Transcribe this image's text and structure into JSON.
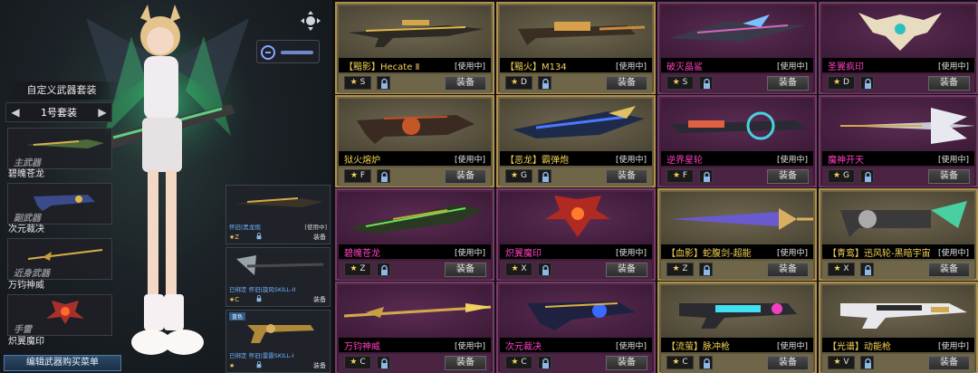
{
  "left_panel": {
    "loadout_title": "自定义武器套装",
    "set_name": "1号套装",
    "prev_arrow": "◀",
    "next_arrow": "▶",
    "slots": [
      {
        "type": "主武器",
        "name": "碧魄苍龙"
      },
      {
        "type": "副武器",
        "name": "次元裁决"
      },
      {
        "type": "近身武器",
        "name": "万钧神威"
      },
      {
        "type": "手雷",
        "name": "炽翼魔印"
      }
    ],
    "edit_button": "编辑武器购买菜单"
  },
  "mid_list": [
    {
      "badge": "",
      "name": "怀旧|黑龙炮",
      "status": "[使用中]",
      "key": "★Z",
      "equip": "装备"
    },
    {
      "badge": "",
      "name": "已绑定 怀旧|旋风SKILL-II",
      "status": "",
      "key": "★C",
      "equip": "装备"
    },
    {
      "badge": "蓝色",
      "name": "已绑定 怀旧|雷霆SKILL-I",
      "status": "",
      "key": "★",
      "equip": "装备"
    }
  ],
  "weapons": [
    {
      "name": "【黯影】Hecate Ⅱ",
      "status": "[使用中]",
      "key": "S",
      "equip": "装备",
      "style": "gold",
      "icon": "sniper-rifle-icon"
    },
    {
      "name": "【黯火】M134",
      "status": "[使用中]",
      "key": "D",
      "equip": "装备",
      "style": "gold",
      "icon": "minigun-icon"
    },
    {
      "name": "破灭晶鲨",
      "status": "[使用中]",
      "key": "S",
      "equip": "装备",
      "style": "purple",
      "icon": "shark-blade-icon"
    },
    {
      "name": "圣翼疯印",
      "status": "[使用中]",
      "key": "D",
      "equip": "装备",
      "style": "purple",
      "icon": "winged-emblem-icon"
    },
    {
      "name": "狱火熔炉",
      "status": "[使用中]",
      "key": "F",
      "equip": "装备",
      "style": "gold",
      "icon": "furnace-gun-icon"
    },
    {
      "name": "【恶龙】霸弹炮",
      "status": "[使用中]",
      "key": "G",
      "equip": "装备",
      "style": "gold",
      "icon": "dragon-cannon-icon"
    },
    {
      "name": "逆界星轮",
      "status": "[使用中]",
      "key": "F",
      "equip": "装备",
      "style": "purple",
      "icon": "star-wheel-icon"
    },
    {
      "name": "魔神开天",
      "status": "[使用中]",
      "key": "G",
      "equip": "装备",
      "style": "purple",
      "icon": "demon-blade-icon"
    },
    {
      "name": "碧魄苍龙",
      "status": "[使用中]",
      "key": "Z",
      "equip": "装备",
      "style": "purple",
      "icon": "jade-dragon-icon"
    },
    {
      "name": "炽翼魔印",
      "status": "[使用中]",
      "key": "X",
      "equip": "装备",
      "style": "purple",
      "icon": "fire-wing-icon"
    },
    {
      "name": "【血影】蛇腹剑-超能",
      "status": "[使用中]",
      "key": "Z",
      "equip": "装备",
      "style": "gold",
      "icon": "serpent-sword-icon"
    },
    {
      "name": "【青鸾】迅风轮-黑暗宇宙",
      "status": "[使用中]",
      "key": "X",
      "equip": "装备",
      "style": "gold",
      "icon": "wind-wheel-icon"
    },
    {
      "name": "万钧神威",
      "status": "[使用中]",
      "key": "C",
      "equip": "装备",
      "style": "purple",
      "icon": "divine-spear-icon"
    },
    {
      "name": "次元裁决",
      "status": "[使用中]",
      "key": "C",
      "equip": "装备",
      "style": "purple",
      "icon": "dimension-gun-icon"
    },
    {
      "name": "【流萤】脉冲枪",
      "status": "[使用中]",
      "key": "C",
      "equip": "装备",
      "style": "gold",
      "icon": "pulse-gun-icon"
    },
    {
      "name": "【光谱】动能枪",
      "status": "[使用中]",
      "key": "V",
      "equip": "装备",
      "style": "gold",
      "icon": "kinetic-gun-icon"
    }
  ]
}
